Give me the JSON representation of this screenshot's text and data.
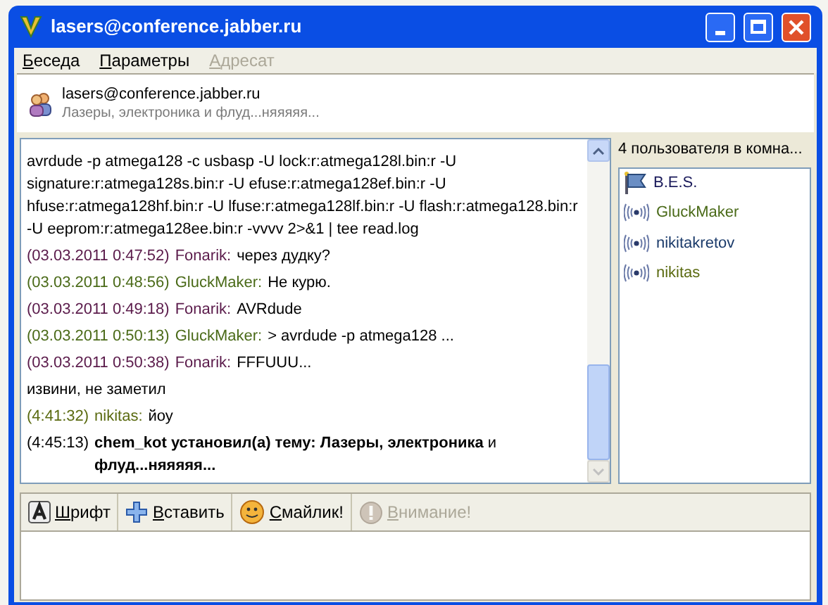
{
  "window": {
    "title": "lasers@conference.jabber.ru"
  },
  "menu": [
    {
      "label": "Беседа",
      "disabled": false
    },
    {
      "label": "Параметры",
      "disabled": false
    },
    {
      "label": "Адресат",
      "disabled": true
    }
  ],
  "header": {
    "jid": "lasers@conference.jabber.ru",
    "topic": "Лазеры, электроника и флуд...няяяяя..."
  },
  "messages": [
    {
      "kind": "plain",
      "text": "avrdude -p atmega128 -c usbasp  -U lock:r:atmega128l.bin:r -U signature:r:atmega128s.bin:r -U efuse:r:atmega128ef.bin:r -U hfuse:r:atmega128hf.bin:r -U lfuse:r:atmega128lf.bin:r -U flash:r:atmega128.bin:r  -U eeprom:r:atmega128ee.bin:r -vvvv 2>&1 | tee read.log"
    },
    {
      "kind": "message",
      "time": "(03.03.2011 0:47:52)",
      "nick": "Fonarik:",
      "color": "#5a1a4a",
      "text": "через дудку?"
    },
    {
      "kind": "message",
      "time": "(03.03.2011 0:48:56)",
      "nick": "GluckMaker:",
      "color": "#4a6a18",
      "text": "Не курю."
    },
    {
      "kind": "message",
      "time": "(03.03.2011 0:49:18)",
      "nick": "Fonarik:",
      "color": "#5a1a4a",
      "text": "AVRdude"
    },
    {
      "kind": "message",
      "time": "(03.03.2011 0:50:13)",
      "nick": "GluckMaker:",
      "color": "#4a6a18",
      "text": "> avrdude -p atmega128 ..."
    },
    {
      "kind": "message",
      "time": "(03.03.2011 0:50:38)",
      "nick": "Fonarik:",
      "color": "#5a1a4a",
      "text": "FFFUUU..."
    },
    {
      "kind": "plain",
      "text": "извини, не заметил"
    },
    {
      "kind": "message",
      "time": "(4:41:32)",
      "nick": "nikitas:",
      "color": "#5a6a10",
      "text": "йоу"
    },
    {
      "kind": "topic",
      "time": "(4:45:13)",
      "text": "**chem_kot установил(а) тему: Лазеры, электроника** и **флуд...няяяяя...**"
    }
  ],
  "users": {
    "heading": "4 пользователя в комна...",
    "items": [
      {
        "kind": "moderator",
        "name": "B.E.S.",
        "color": "#1a1a5a"
      },
      {
        "kind": "participant",
        "name": "GluckMaker",
        "color": "#4a6a18"
      },
      {
        "kind": "participant",
        "name": "nikitakretov",
        "color": "#1a3a6a"
      },
      {
        "kind": "participant",
        "name": "nikitas",
        "color": "#5a6a10"
      }
    ]
  },
  "toolbar": [
    {
      "kind": "font",
      "label": "Шрифт",
      "disabled": false
    },
    {
      "kind": "insert",
      "label": "Вставить",
      "disabled": false
    },
    {
      "kind": "smiley",
      "label": "Смайлик!",
      "disabled": false
    },
    {
      "kind": "attention",
      "label": "Внимание!",
      "disabled": true
    }
  ]
}
